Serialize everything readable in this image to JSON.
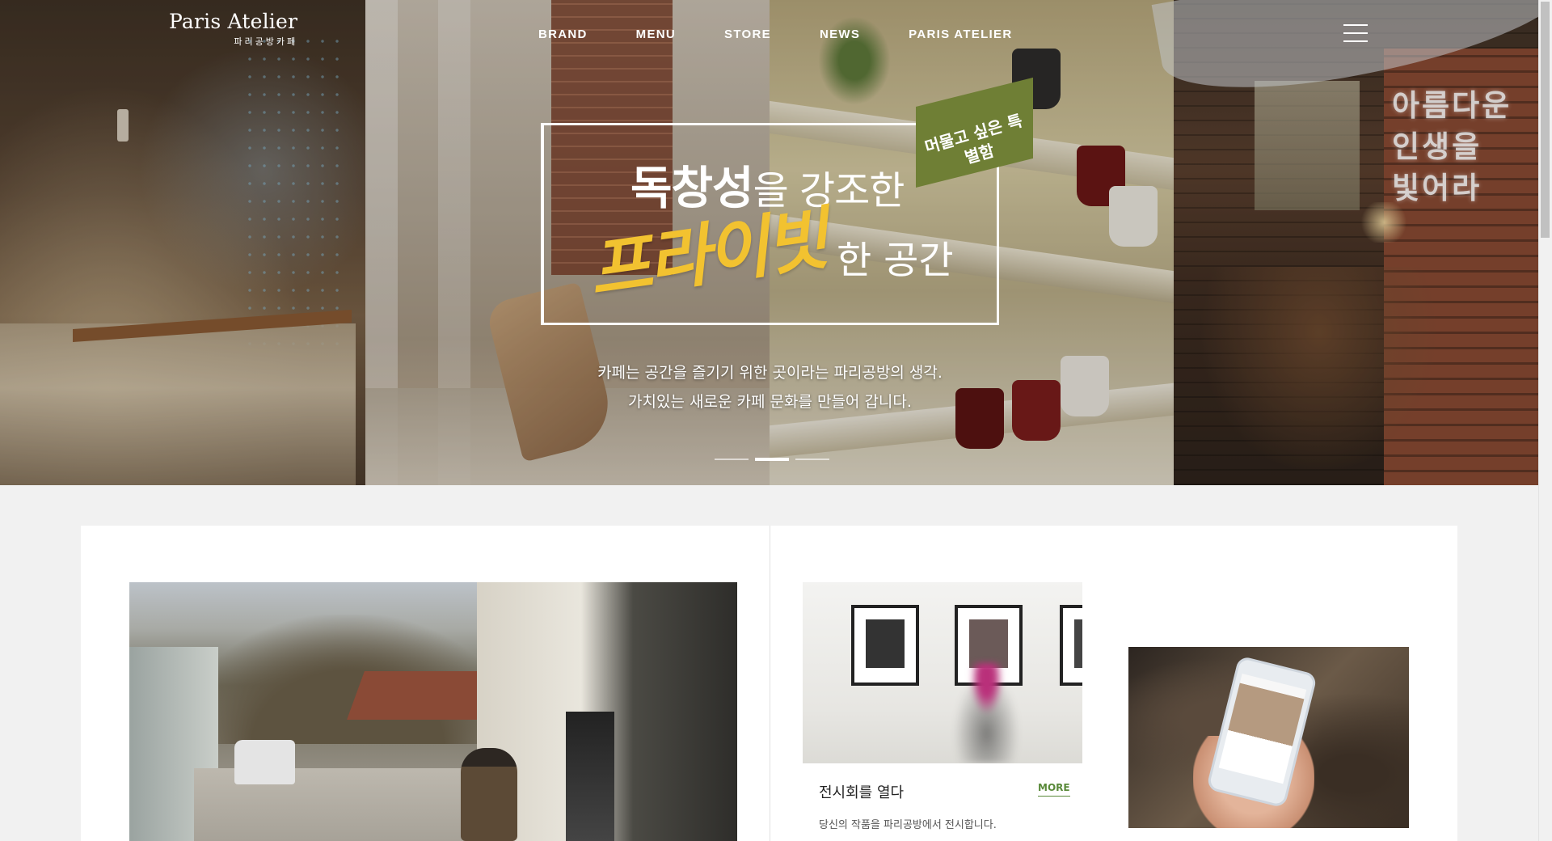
{
  "header": {
    "logo_main": "Paris Atelier",
    "logo_sub": "파리공방카페",
    "nav": [
      "BRAND",
      "MENU",
      "STORE",
      "NEWS",
      "PARIS ATELIER"
    ]
  },
  "hero": {
    "tag": "머물고 싶은 특별함",
    "headline_bold": "독창성",
    "headline_rest": "을 강조한",
    "script_word": "프라이빗",
    "line2_rest": "한 공간",
    "desc_line1": "카페는 공간을 즐기기 위한 곳이라는 파리공방의 생각.",
    "desc_line2": "가치있는 새로운 카페 문화를 만들어 갑니다.",
    "neon_sign": "아름다운 인생을 빛어라",
    "slides": 3,
    "active_slide": 2
  },
  "cards": {
    "exhibit": {
      "title": "전시회를 열다",
      "more": "MORE",
      "desc": "당신의 작품을 파리공방에서 전시합니다."
    }
  },
  "colors": {
    "accent_yellow": "#f2c230",
    "tag_green": "#6f7f35",
    "more_green": "#5a8a3a"
  }
}
